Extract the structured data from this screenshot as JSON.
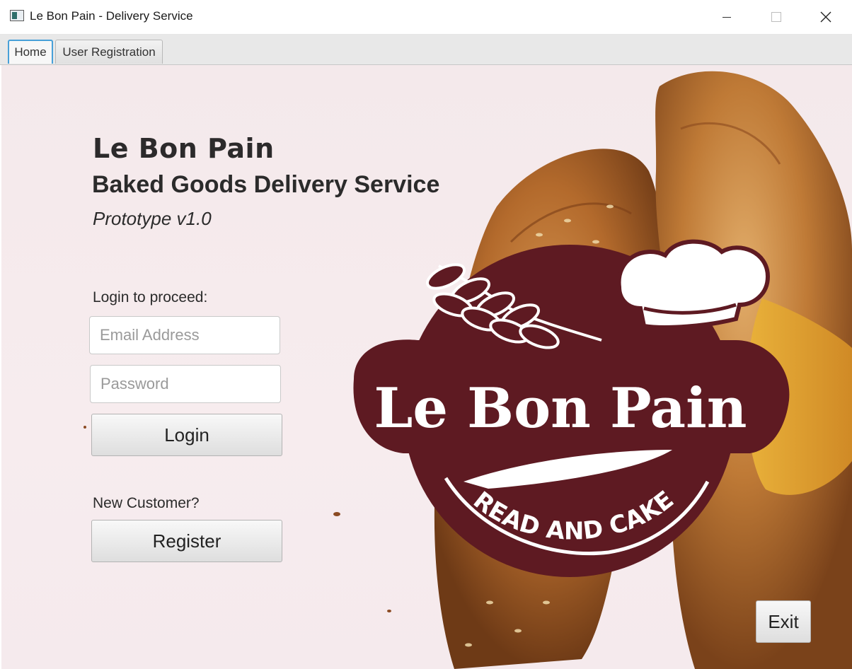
{
  "window": {
    "title": "Le Bon Pain - Delivery Service",
    "icon": "app-window-icon"
  },
  "tabs": [
    {
      "label": "Home",
      "selected": true
    },
    {
      "label": "User Registration",
      "selected": false
    }
  ],
  "home": {
    "brand_title": "Le Bon Pain",
    "subtitle": "Baked Goods Delivery Service",
    "version": "Prototype v1.0",
    "login_prompt": "Login to proceed:",
    "email_placeholder": "Email Address",
    "password_placeholder": "Password",
    "login_label": "Login",
    "new_customer_prompt": "New Customer?",
    "register_label": "Register",
    "exit_label": "Exit"
  },
  "logo": {
    "name": "Le Bon Pain",
    "tagline": "BREAD AND CAKES",
    "color": "#5e1a22"
  },
  "colors": {
    "background": "#f5eaed",
    "tab_focus": "#48a0d8"
  }
}
